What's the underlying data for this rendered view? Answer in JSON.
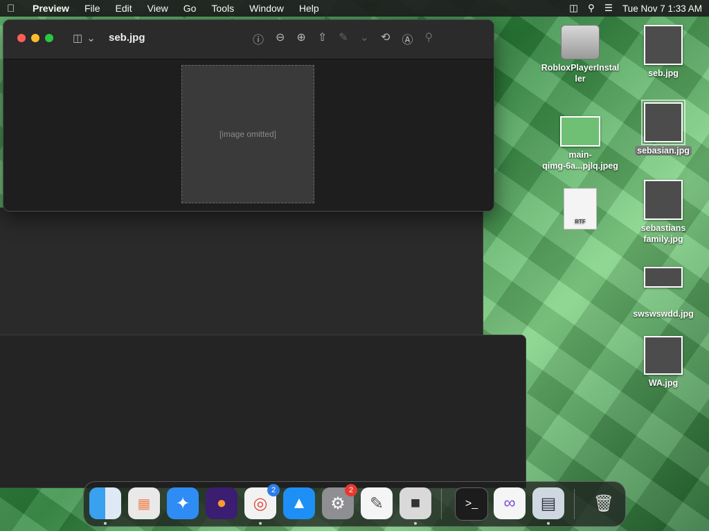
{
  "menubar": {
    "app_name": "Preview",
    "menus": [
      "File",
      "Edit",
      "View",
      "Go",
      "Tools",
      "Window",
      "Help"
    ],
    "clock": "Tue Nov 7  1:33 AM"
  },
  "preview": {
    "title": "seb.jpg",
    "photo_placeholder": "[image omitted]"
  },
  "desktop": {
    "icons": [
      {
        "label": "RobloxPlayerInstal\nler",
        "kind": "disk"
      },
      {
        "label": "main-\nqimg-6a...pjlq.jpeg",
        "kind": "image"
      },
      {
        "label": "",
        "kind": "rtf",
        "badge": "RTF"
      },
      {
        "label": "seb.jpg",
        "kind": "image"
      },
      {
        "label": "sebasian.jpg",
        "kind": "image",
        "selected": true
      },
      {
        "label": "sebastians\nfamily.jpg",
        "kind": "image"
      },
      {
        "label": "swswswdd.jpg",
        "kind": "image"
      },
      {
        "label": "WA.jpg",
        "kind": "image"
      }
    ]
  },
  "dock": {
    "apps": [
      "Finder",
      "Launchpad",
      "Safari",
      "Firefox",
      "Chrome",
      "App Store",
      "System Settings",
      "TextEdit",
      "Roblox",
      "Terminal",
      "Visual Studio",
      "Preview",
      "Trash"
    ],
    "chrome_badge": "2",
    "settings_badge": "2"
  },
  "colors": {
    "close": "#ff5f57",
    "minimize": "#febc2e",
    "maximize": "#28c840",
    "badge": "#e5392f"
  }
}
